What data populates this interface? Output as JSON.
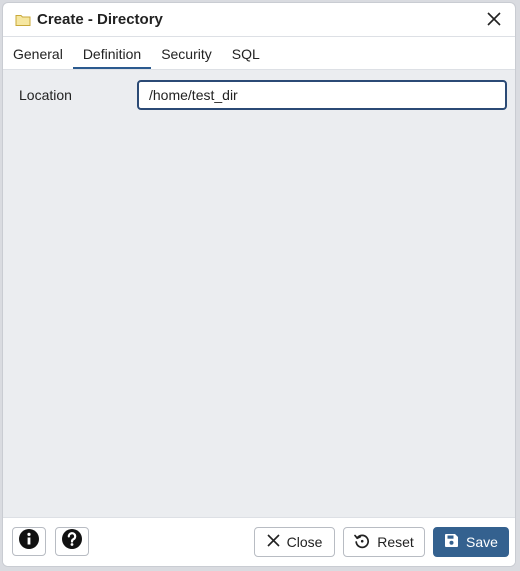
{
  "dialog": {
    "title": "Create - Directory",
    "folder_icon": "folder-icon",
    "close_icon": "close-icon"
  },
  "tabs": [
    {
      "label": "General",
      "active": false
    },
    {
      "label": "Definition",
      "active": true
    },
    {
      "label": "Security",
      "active": false
    },
    {
      "label": "SQL",
      "active": false
    }
  ],
  "form": {
    "location_label": "Location",
    "location_value": "/home/test_dir"
  },
  "footer": {
    "info_icon": "info-icon",
    "help_icon": "help-icon",
    "close_label": "Close",
    "reset_label": "Reset",
    "save_label": "Save"
  },
  "colors": {
    "accent": "#34618f",
    "content_bg": "#ebedf0"
  }
}
